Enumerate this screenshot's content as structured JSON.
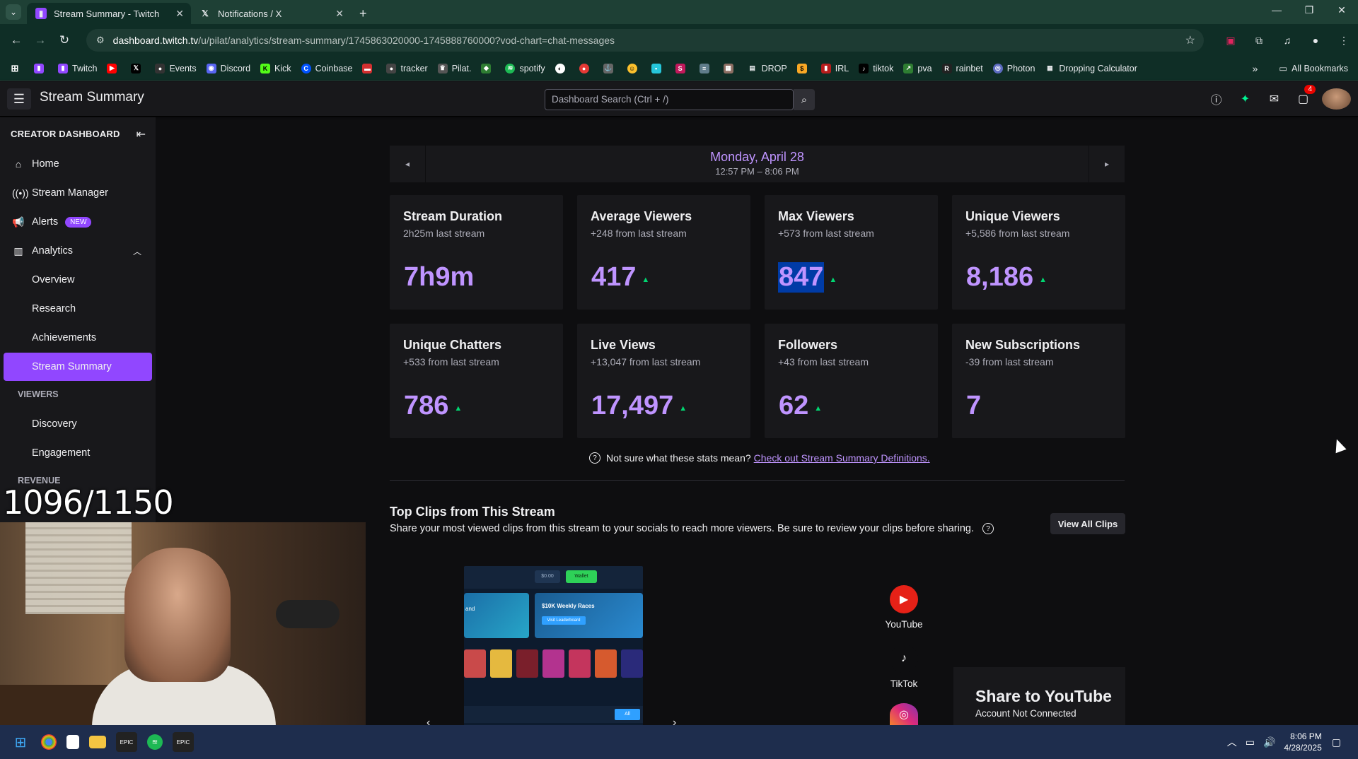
{
  "browser": {
    "tabs": [
      {
        "title": "Stream Summary - Twitch",
        "active": true
      },
      {
        "title": "Notifications / X",
        "active": false
      }
    ],
    "url_host": "dashboard.twitch.tv",
    "url_path": "/u/pilat/analytics/stream-summary/1745863020000-1745888760000?vod-chart=chat-messages",
    "bookmarks": [
      "Twitch",
      "Events",
      "Discord",
      "Kick",
      "Coinbase",
      "tracker",
      "Pilat.",
      "spotify",
      "DROP",
      "IRL",
      "tiktok",
      "pva",
      "rainbet",
      "Photon",
      "Dropping Calculator"
    ],
    "all_bookmarks": "All Bookmarks"
  },
  "header": {
    "title": "Stream Summary",
    "search_placeholder": "Dashboard Search (Ctrl + /)",
    "notification_count": "4"
  },
  "sidebar": {
    "heading": "CREATOR DASHBOARD",
    "items": {
      "home": "Home",
      "stream_manager": "Stream Manager",
      "alerts": "Alerts",
      "alerts_badge": "NEW",
      "analytics": "Analytics",
      "overview": "Overview",
      "research": "Research",
      "achievements": "Achievements",
      "stream_summary": "Stream Summary",
      "viewers_section": "VIEWERS",
      "discovery": "Discovery",
      "engagement": "Engagement",
      "revenue_section": "REVENUE"
    }
  },
  "overlay": {
    "counter": "1096/1150"
  },
  "summary": {
    "date": "Monday, April 28",
    "time_range": "12:57 PM – 8:06 PM",
    "stats": [
      {
        "label": "Stream Duration",
        "delta": "2h25m last stream",
        "value": "7h9m",
        "up": false
      },
      {
        "label": "Average Viewers",
        "delta": "+248 from last stream",
        "value": "417",
        "up": true
      },
      {
        "label": "Max Viewers",
        "delta": "+573 from last stream",
        "value": "847",
        "up": true
      },
      {
        "label": "Unique Viewers",
        "delta": "+5,586 from last stream",
        "value": "8,186",
        "up": true
      },
      {
        "label": "Unique Chatters",
        "delta": "+533 from last stream",
        "value": "786",
        "up": true
      },
      {
        "label": "Live Views",
        "delta": "+13,047 from last stream",
        "value": "17,497",
        "up": true
      },
      {
        "label": "Followers",
        "delta": "+43 from last stream",
        "value": "62",
        "up": true
      },
      {
        "label": "New Subscriptions",
        "delta": "-39 from last stream",
        "value": "7",
        "up": false
      }
    ],
    "help_text": "Not sure what these stats mean?",
    "help_link": "Check out Stream Summary Definitions."
  },
  "clips": {
    "title": "Top Clips from This Stream",
    "description": "Share your most viewed clips from this stream to your socials to reach more viewers. Be sure to review your clips before sharing.",
    "view_all": "View All Clips",
    "thumb": {
      "amount": "$0.00",
      "wallet": "Wallet",
      "banner_left": "and",
      "banner_title": "$10K Weekly Races",
      "banner_button": "Visit Leaderboard",
      "bottom_button": "All"
    },
    "socials": {
      "youtube": "YouTube",
      "tiktok": "TikTok"
    },
    "share_title": "Share to YouTube",
    "share_status": "Account Not Connected"
  },
  "taskbar": {
    "time": "8:06 PM",
    "date": "4/28/2025"
  }
}
